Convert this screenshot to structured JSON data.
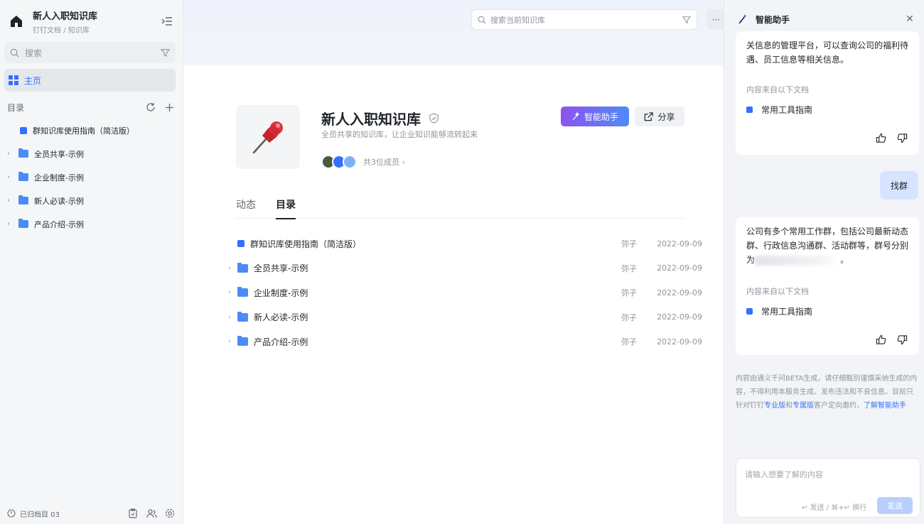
{
  "sidebar": {
    "kb_title": "新人入职知识库",
    "breadcrumb": "钉钉文档 / 知识库",
    "search_placeholder": "搜索",
    "home_label": "主页",
    "directory_label": "目录",
    "tree": [
      {
        "label": "群知识库使用指南（简洁版）",
        "kind": "doc"
      },
      {
        "label": "全员共享-示例",
        "kind": "folder"
      },
      {
        "label": "企业制度-示例",
        "kind": "folder"
      },
      {
        "label": "新人必读-示例",
        "kind": "folder"
      },
      {
        "label": "产品介绍-示例",
        "kind": "folder"
      }
    ],
    "footer_label": "已归档目 03"
  },
  "main": {
    "search_placeholder": "搜索当前知识库",
    "more_label": "···",
    "kb_name": "新人入职知识库",
    "kb_desc": "全员共享的知识库，让企业知识能够流转起来",
    "members_label": "共3位成员 ›",
    "ai_button": "智能助手",
    "share_button": "分享",
    "tabs": [
      "动态",
      "目录"
    ],
    "active_tab": "目录",
    "rows": [
      {
        "name": "群知识库使用指南（简洁版）",
        "kind": "doc",
        "owner": "弥子",
        "date": "2022-09-09"
      },
      {
        "name": "全员共享-示例",
        "kind": "folder",
        "owner": "弥子",
        "date": "2022-09-09"
      },
      {
        "name": "企业制度-示例",
        "kind": "folder",
        "owner": "弥子",
        "date": "2022-09-09"
      },
      {
        "name": "新人必读-示例",
        "kind": "folder",
        "owner": "弥子",
        "date": "2022-09-09"
      },
      {
        "name": "产品介绍-示例",
        "kind": "folder",
        "owner": "弥子",
        "date": "2022-09-09"
      }
    ]
  },
  "assistant": {
    "title": "智能助手",
    "card1_text": "关信息的管理平台，可以查询公司的福利待遇、员工信息等相关信息。",
    "source_label": "内容来自以下文档",
    "source_doc": "常用工具指南",
    "user_message": "找群",
    "card2_text_a": "公司有多个常用工作群，包括公司最新动态群、行政信息沟通群、活动群等，群号分别为",
    "card2_text_b": "。",
    "disclaimer_a": "内容由通义千问BETA生成，请仔细甄别谨慎采纳生成的内容，不得利用本服务生成、发布违法和不良信息。目前只针对钉钉",
    "disclaimer_link1": "专业版",
    "disclaimer_mid": "和",
    "disclaimer_link2": "专属版",
    "disclaimer_b": "客户定向邀约，",
    "disclaimer_link3": "了解智能助手",
    "input_placeholder": "请输入想要了解的内容",
    "input_hint": "↵ 发送 / ⌘+↵ 换行",
    "send_button": "发送"
  },
  "colors": {
    "accent": "#3370ff",
    "ai_gradient_start": "#8d53f0",
    "ai_gradient_end": "#4e8bf6",
    "folder": "#4c8bf5"
  }
}
